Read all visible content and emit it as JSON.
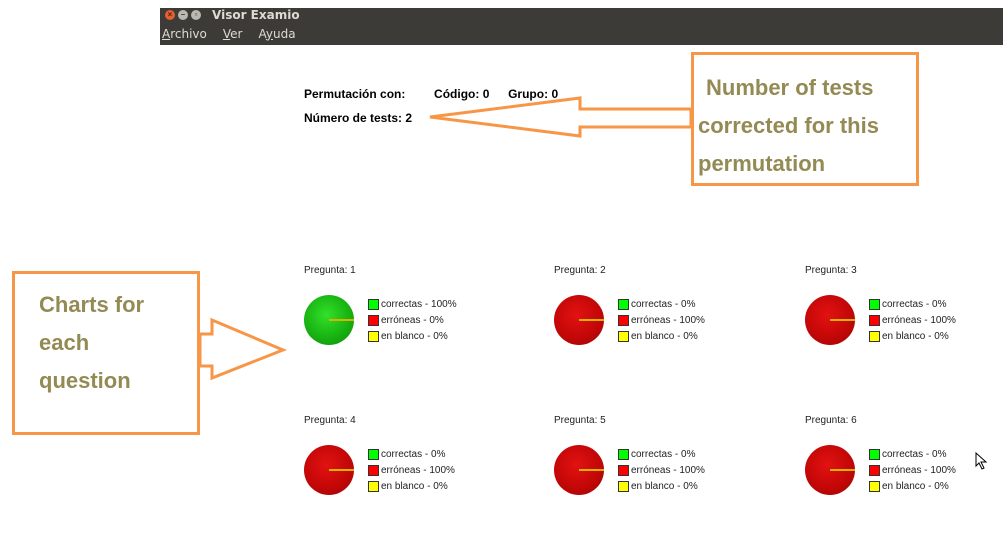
{
  "window": {
    "title": "Visor Examio",
    "controls": [
      "close-icon",
      "minimize-icon",
      "maximize-icon"
    ]
  },
  "menu": {
    "items": [
      {
        "pre": "",
        "u": "A",
        "post": "rchivo"
      },
      {
        "pre": "",
        "u": "V",
        "post": "er"
      },
      {
        "pre": "A",
        "u": "y",
        "post": "uda"
      }
    ]
  },
  "header": {
    "permutacion_label": "Permutación con:",
    "codigo_label": "Código:",
    "codigo_value": "0",
    "grupo_label": "Grupo:",
    "grupo_value": "0",
    "numero_label": "Número de tests:",
    "numero_value": "2"
  },
  "callouts": {
    "tests": [
      "Number of  tests",
      "corrected for this",
      "permutation"
    ],
    "charts": [
      "Charts for",
      "each",
      "question"
    ]
  },
  "colors": {
    "correct": "#00ff00",
    "wrong": "#ff0000",
    "blank": "#ffff00",
    "callout_border": "#f79646",
    "callout_text": "#948a54"
  },
  "questions": [
    {
      "title": "Pregunta: 1",
      "pie_color": "green",
      "legend": [
        "correctas - 100%",
        "erróneas - 0%",
        "en blanco - 0%"
      ]
    },
    {
      "title": "Pregunta: 2",
      "pie_color": "red",
      "legend": [
        "correctas - 0%",
        "erróneas - 100%",
        "en blanco - 0%"
      ]
    },
    {
      "title": "Pregunta: 3",
      "pie_color": "red",
      "legend": [
        "correctas - 0%",
        "erróneas - 100%",
        "en blanco - 0%"
      ]
    },
    {
      "title": "Pregunta: 4",
      "pie_color": "red",
      "legend": [
        "correctas - 0%",
        "erróneas - 100%",
        "en blanco - 0%"
      ]
    },
    {
      "title": "Pregunta: 5",
      "pie_color": "red",
      "legend": [
        "correctas - 0%",
        "erróneas - 100%",
        "en blanco - 0%"
      ]
    },
    {
      "title": "Pregunta: 6",
      "pie_color": "red",
      "legend": [
        "correctas - 0%",
        "erróneas - 100%",
        "en blanco - 0%"
      ]
    }
  ]
}
